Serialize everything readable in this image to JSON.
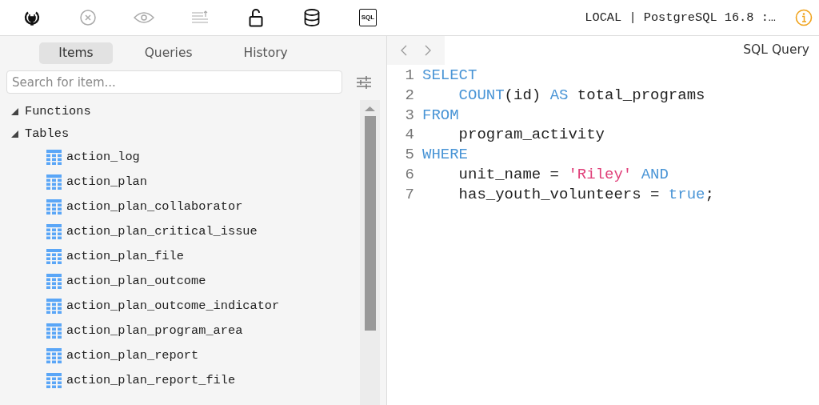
{
  "toolbar": {
    "buttons": [
      {
        "kind": "plug",
        "disabled": false
      },
      {
        "kind": "cancel",
        "disabled": true
      },
      {
        "kind": "eye",
        "disabled": true
      },
      {
        "kind": "lines",
        "disabled": true
      },
      {
        "kind": "lock",
        "disabled": false
      },
      {
        "kind": "database",
        "disabled": false
      },
      {
        "kind": "sql",
        "disabled": false,
        "label": "SQL"
      }
    ],
    "connection": "LOCAL | PostgreSQL 16.8 :…"
  },
  "sidebar": {
    "tabs": [
      {
        "label": "Items",
        "selected": true
      },
      {
        "label": "Queries",
        "selected": false
      },
      {
        "label": "History",
        "selected": false
      }
    ],
    "search": {
      "placeholder": "Search for item..."
    },
    "tree": [
      {
        "label": "Functions",
        "expanded": true
      },
      {
        "label": "Tables",
        "expanded": true,
        "children": [
          {
            "label": "action_log"
          },
          {
            "label": "action_plan"
          },
          {
            "label": "action_plan_collaborator"
          },
          {
            "label": "action_plan_critical_issue"
          },
          {
            "label": "action_plan_file"
          },
          {
            "label": "action_plan_outcome"
          },
          {
            "label": "action_plan_outcome_indicator"
          },
          {
            "label": "action_plan_program_area"
          },
          {
            "label": "action_plan_report"
          },
          {
            "label": "action_plan_report_file"
          }
        ]
      }
    ]
  },
  "editor": {
    "title": "SQL Query",
    "lines": [
      {
        "number": "1",
        "tokens": [
          {
            "text": "SELECT",
            "kind": "keyword"
          }
        ]
      },
      {
        "number": "2",
        "indented": true,
        "tokens": [
          {
            "text": "COUNT",
            "kind": "keyword"
          },
          {
            "text": "(id) ",
            "kind": "plain"
          },
          {
            "text": "AS",
            "kind": "keyword"
          },
          {
            "text": " total_programs",
            "kind": "plain"
          }
        ]
      },
      {
        "number": "3",
        "tokens": [
          {
            "text": "FROM",
            "kind": "keyword"
          }
        ]
      },
      {
        "number": "4",
        "indented": true,
        "tokens": [
          {
            "text": "program_activity",
            "kind": "plain"
          }
        ]
      },
      {
        "number": "5",
        "tokens": [
          {
            "text": "WHERE",
            "kind": "keyword"
          }
        ]
      },
      {
        "number": "6",
        "indented": true,
        "tokens": [
          {
            "text": "unit_name = ",
            "kind": "plain"
          },
          {
            "text": "'Riley'",
            "kind": "string"
          },
          {
            "text": " AND",
            "kind": "keyword"
          }
        ]
      },
      {
        "number": "7",
        "indented": true,
        "tokens": [
          {
            "text": "has_youth_volunteers = ",
            "kind": "plain"
          },
          {
            "text": "true",
            "kind": "keyword"
          },
          {
            "text": ";",
            "kind": "plain"
          }
        ]
      }
    ]
  }
}
